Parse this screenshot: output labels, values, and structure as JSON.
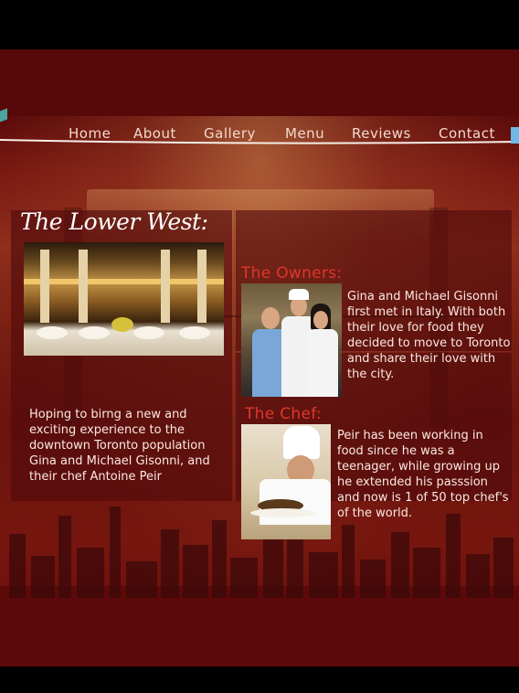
{
  "nav": {
    "items": [
      {
        "label": "Home"
      },
      {
        "label": "About"
      },
      {
        "label": "Gallery"
      },
      {
        "label": "Menu"
      },
      {
        "label": "Reviews"
      },
      {
        "label": "Contact"
      }
    ]
  },
  "left": {
    "title": "The Lower West:",
    "text": "Hoping to birng a new and exciting experience to the downtown Toronto population Gina and Michael Gisonni, and their chef Antoine Peir"
  },
  "owners": {
    "title": "The Owners:",
    "text": "Gina and Michael Gisonni first met in Italy. With both their love for food they decided to move to Toronto and share their love with the city."
  },
  "chef": {
    "title": "The Chef:",
    "text": "Peir has been working in food since he was a teenager, while growing up he extended his passsion and now is 1 of 50 top chef's of the world."
  },
  "colors": {
    "accent": "#e0362b",
    "background": "#5a0a0a",
    "nav_text": "#f1d9cf"
  }
}
